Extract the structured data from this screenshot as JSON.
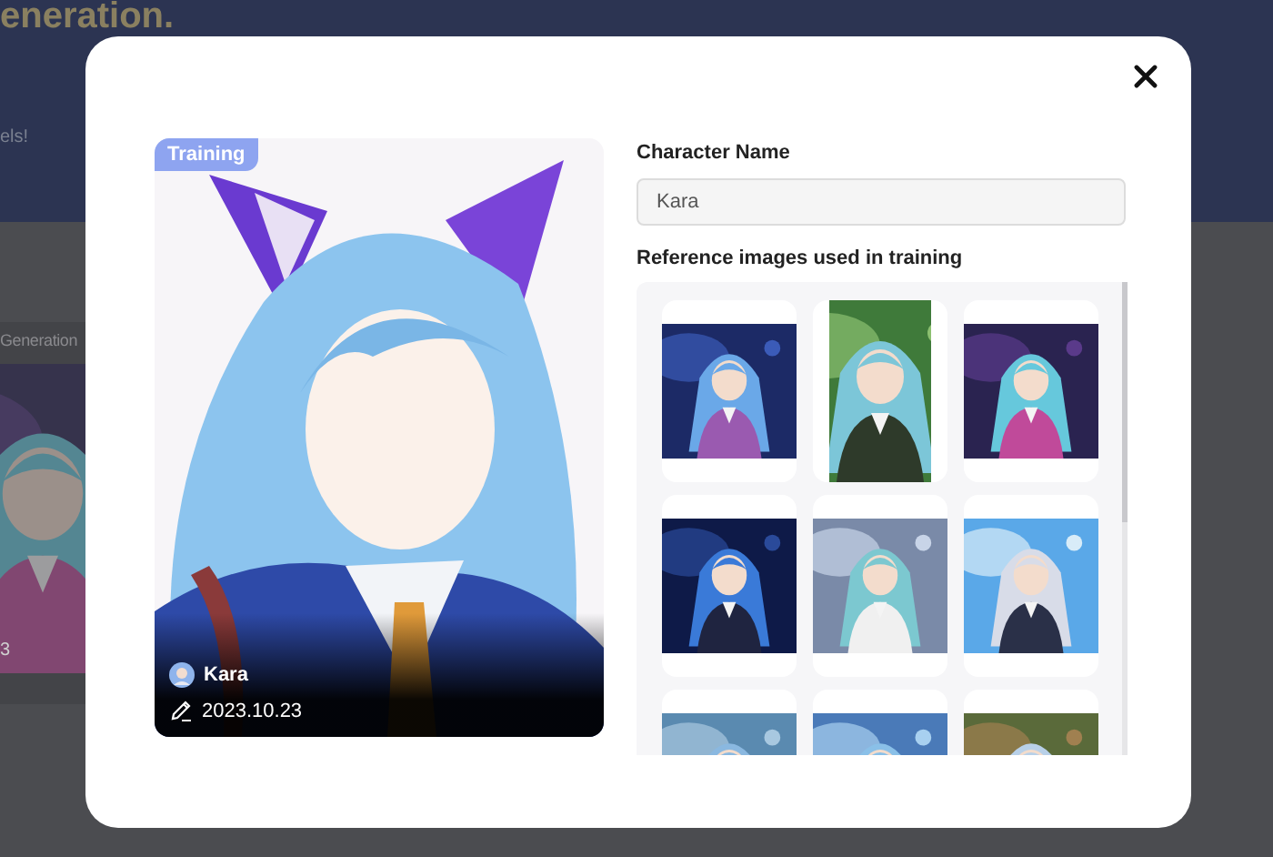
{
  "background": {
    "heading": "eneration.",
    "subtitle": "els!",
    "card_title": "Generation",
    "card_caption": "3"
  },
  "dialog": {
    "preview": {
      "badge": "Training",
      "name": "Kara",
      "date": "2023.10.23"
    },
    "name_label": "Character Name",
    "name_value": "Kara",
    "references_label": "Reference images used in training"
  }
}
